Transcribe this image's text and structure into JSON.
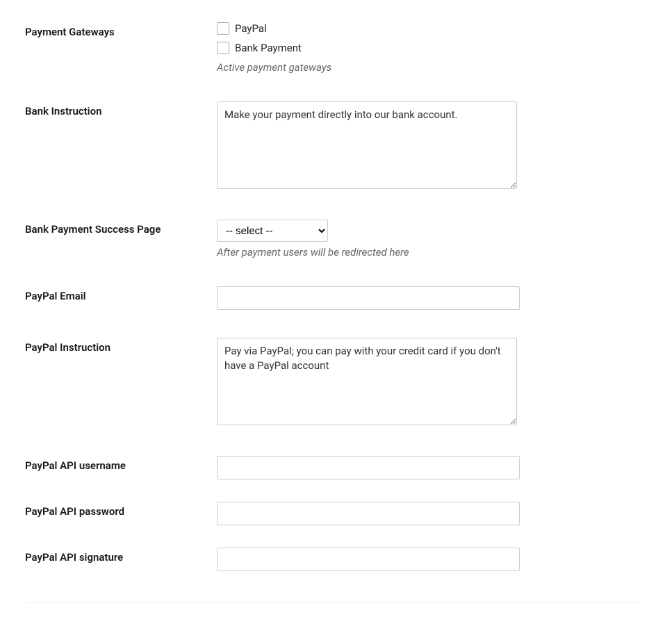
{
  "fields": {
    "payment_gateways": {
      "label": "Payment Gateways",
      "option_paypal": "PayPal",
      "option_bank": "Bank Payment",
      "description": "Active payment gateways"
    },
    "bank_instruction": {
      "label": "Bank Instruction",
      "value": "Make your payment directly into our bank account."
    },
    "bank_success_page": {
      "label": "Bank Payment Success Page",
      "selected": "-- select --",
      "description": "After payment users will be redirected here"
    },
    "paypal_email": {
      "label": "PayPal Email",
      "value": ""
    },
    "paypal_instruction": {
      "label": "PayPal Instruction",
      "value": "Pay via PayPal; you can pay with your credit card if you don't have a PayPal account"
    },
    "paypal_api_username": {
      "label": "PayPal API username",
      "value": ""
    },
    "paypal_api_password": {
      "label": "PayPal API password",
      "value": ""
    },
    "paypal_api_signature": {
      "label": "PayPal API signature",
      "value": ""
    }
  }
}
